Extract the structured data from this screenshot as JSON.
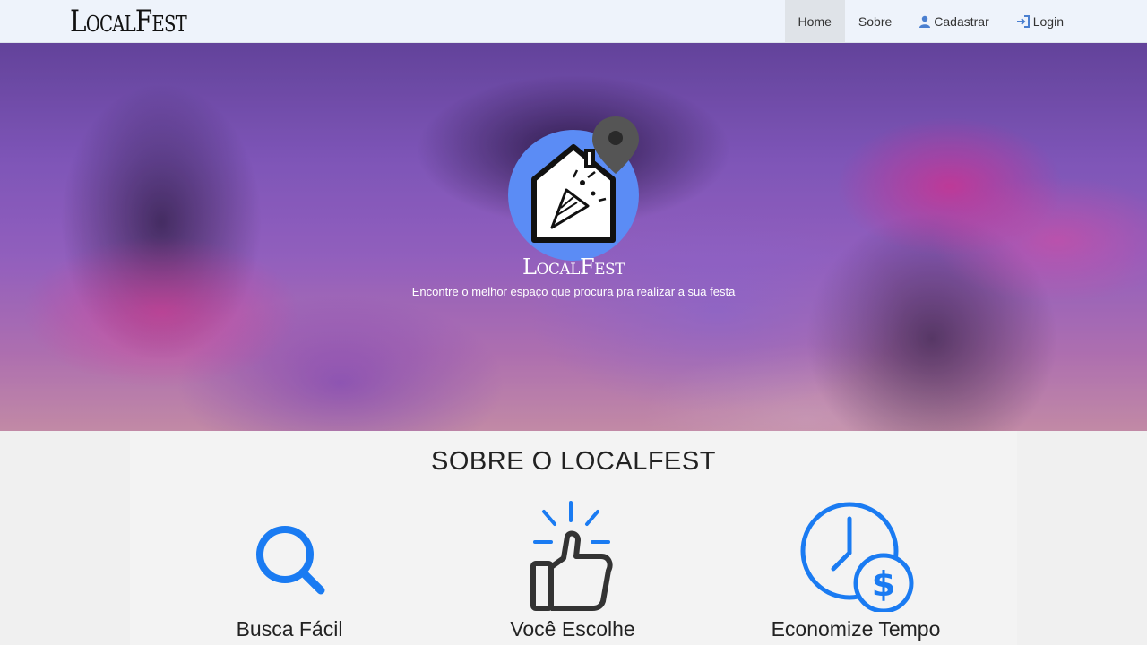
{
  "brand": "LocalFest",
  "nav": [
    {
      "label": "Home",
      "active": true
    },
    {
      "label": "Sobre"
    },
    {
      "label": "Cadastrar",
      "icon": "user-icon"
    },
    {
      "label": "Login",
      "icon": "login-icon"
    }
  ],
  "hero": {
    "logo_text": "LocalFest",
    "tagline": "Encontre o melhor espaço que procura pra realizar a sua festa"
  },
  "about": {
    "title": "SOBRE O LOCALFEST",
    "features": [
      {
        "title": "Busca Fácil",
        "icon": "search-icon"
      },
      {
        "title": "Você Escolhe",
        "icon": "thumbs-up-icon"
      },
      {
        "title": "Economize Tempo",
        "icon": "clock-dollar-icon"
      }
    ]
  },
  "colors": {
    "accent_blue": "#1a7bf2",
    "logo_circle": "#5b8cf5",
    "pin_gray": "#555"
  }
}
